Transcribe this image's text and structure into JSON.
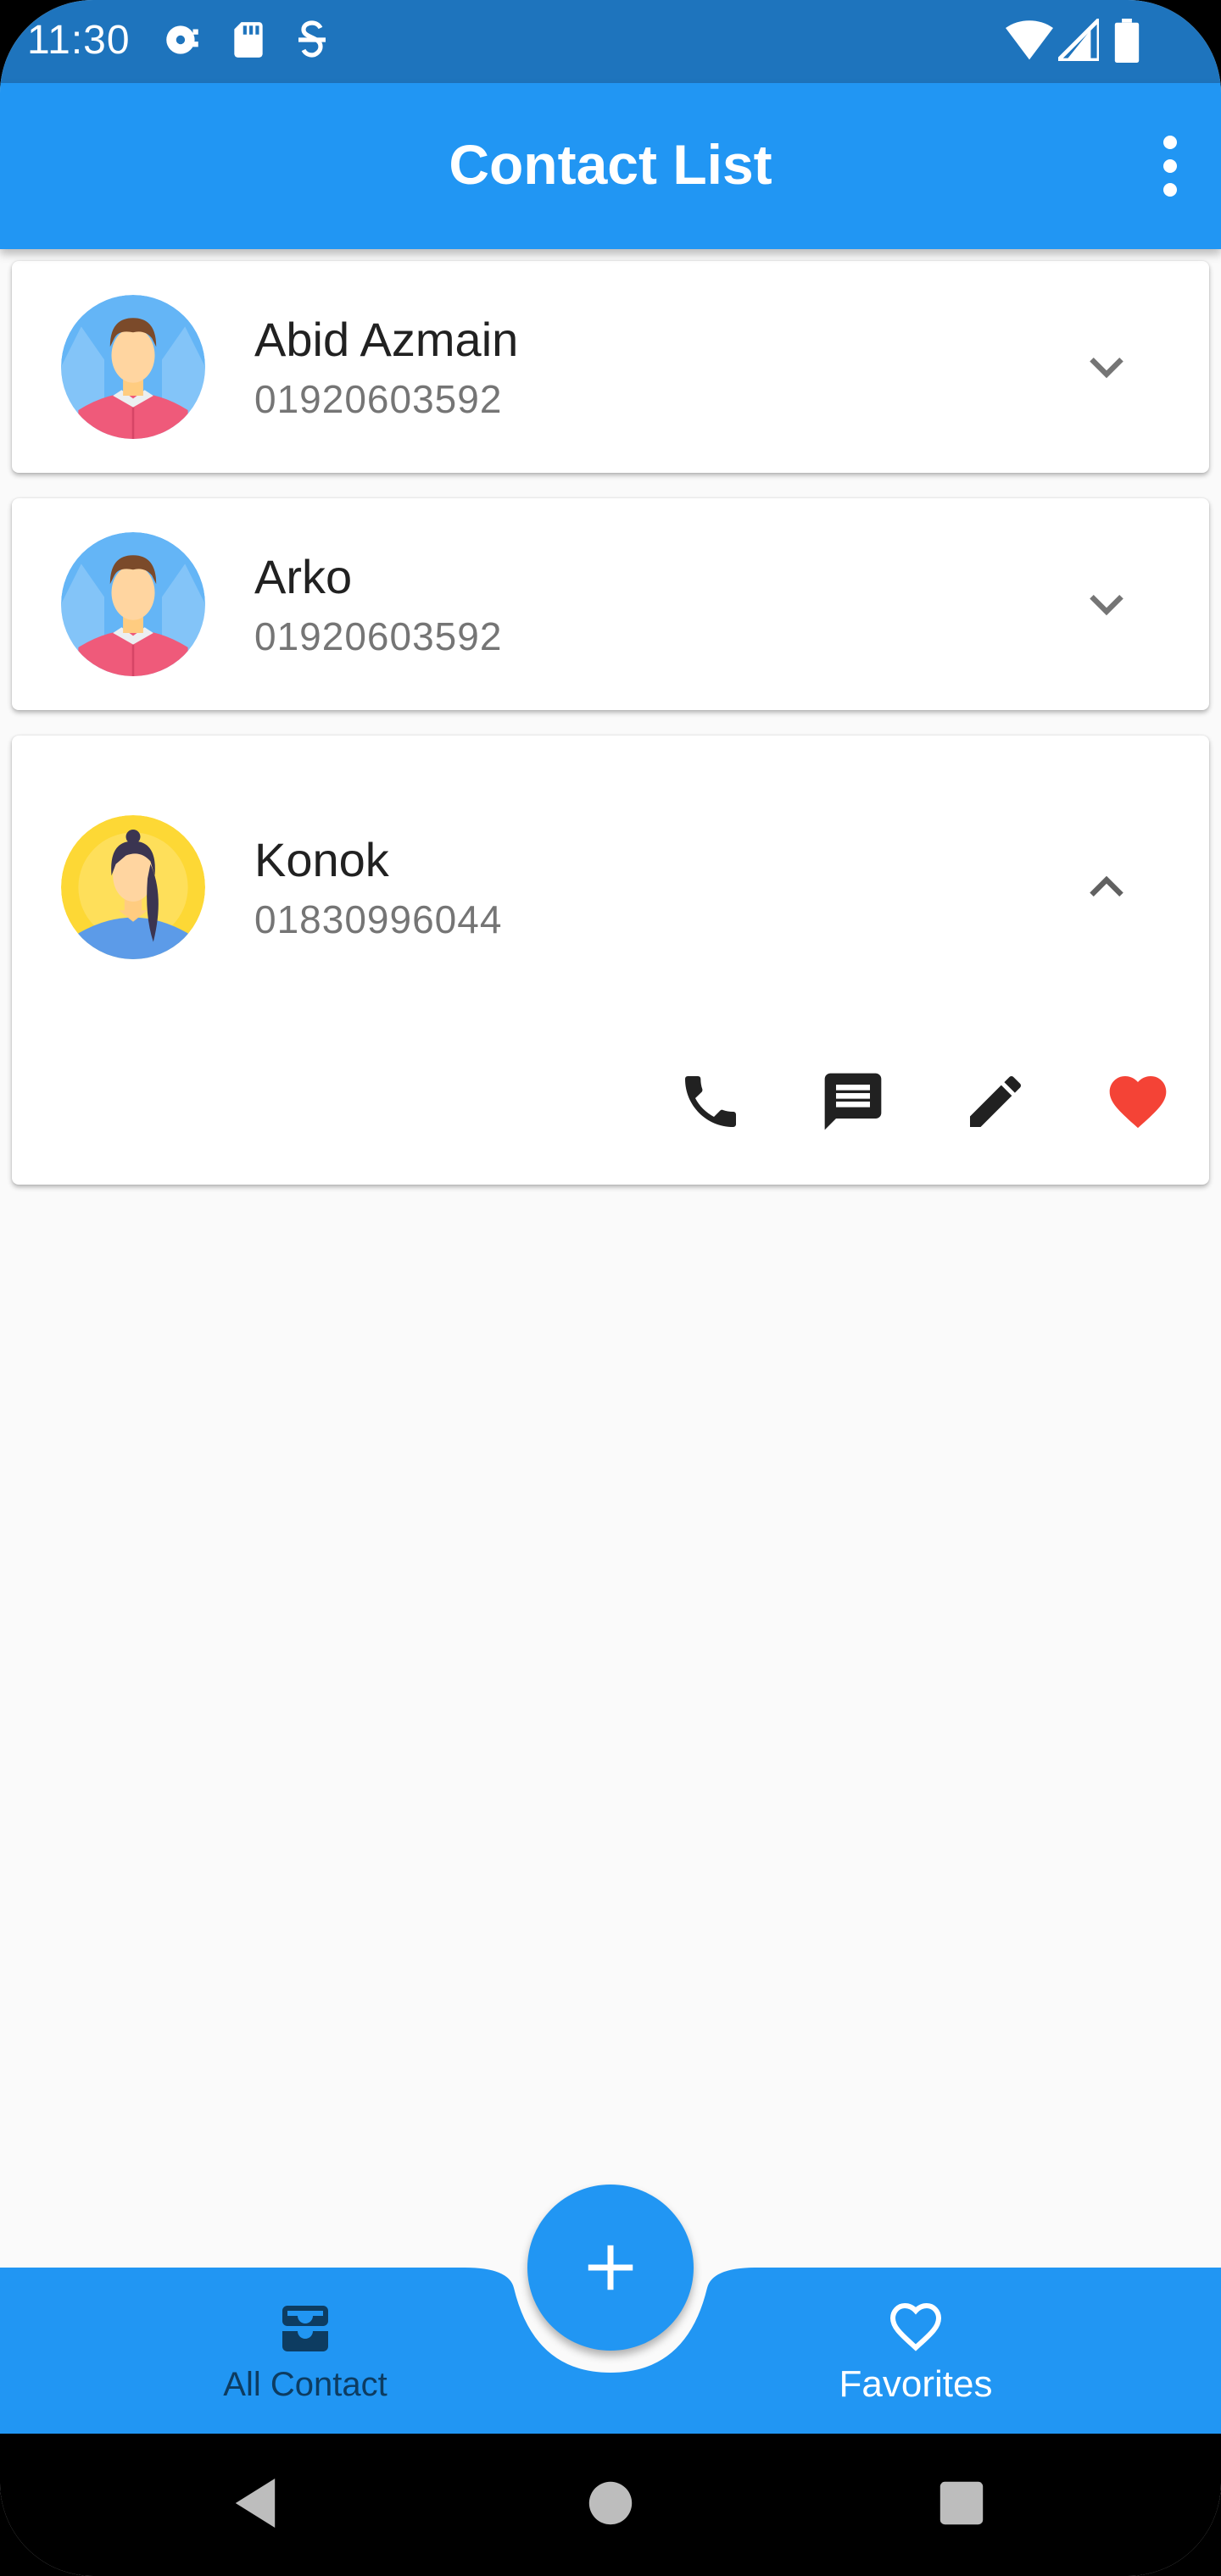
{
  "status_bar": {
    "time": "11:30",
    "icons": [
      "radio-icon",
      "sd-card-icon",
      "signal-s-icon",
      "wifi-icon",
      "cell-signal-icon",
      "battery-icon"
    ]
  },
  "app_bar": {
    "title": "Contact List",
    "menu_icon": "more-vert-icon"
  },
  "contacts": [
    {
      "name": "Abid Azmain",
      "phone": "01920603592",
      "avatar": "male-avatar",
      "expanded": false
    },
    {
      "name": "Arko",
      "phone": "01920603592",
      "avatar": "male-avatar",
      "expanded": false
    },
    {
      "name": "Konok",
      "phone": "01830996044",
      "avatar": "female-avatar",
      "expanded": true,
      "actions": [
        "phone-icon",
        "message-icon",
        "edit-icon",
        "favorite-icon"
      ]
    }
  ],
  "fab": {
    "icon": "add-icon"
  },
  "bottom_nav": {
    "items": [
      {
        "label": "All Contact",
        "icon": "inbox-icon",
        "selected": false
      },
      {
        "label": "Favorites",
        "icon": "heart-outline-icon",
        "selected": true
      }
    ]
  },
  "system_nav": {
    "icons": [
      "back-icon",
      "home-icon",
      "recents-icon"
    ]
  },
  "colors": {
    "primary": "#2196f3",
    "status_bar": "#1e74bd",
    "favorite": "#f44336",
    "unselected_nav": "#0d3c61"
  }
}
